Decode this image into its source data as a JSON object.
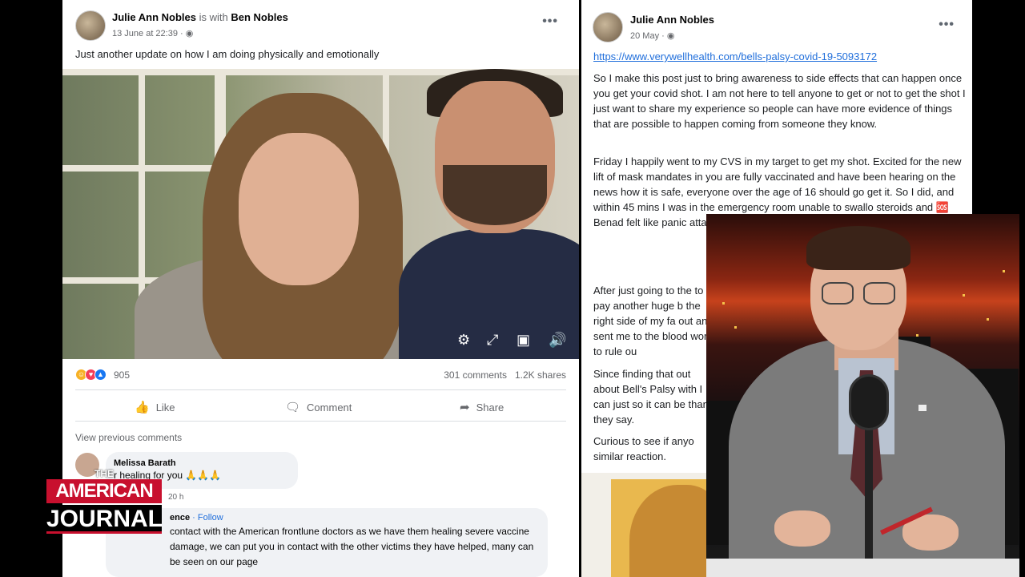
{
  "left_post": {
    "author": "Julie Ann Nobles",
    "with_text": "is with",
    "tagged": "Ben Nobles",
    "date": "13 June at 22:39 ·",
    "privacy_icon": "globe-icon",
    "more_icon": "•••",
    "caption": "Just another update on how I am doing physically and emotionally",
    "video_controls": [
      "gear-icon",
      "expand-icon",
      "picture-in-picture-icon",
      "volume-icon"
    ],
    "reactions": {
      "count": "905",
      "icons": [
        "haha",
        "love",
        "like"
      ]
    },
    "stats": {
      "comments": "301 comments",
      "shares": "1.2K shares"
    },
    "actions": {
      "like": "Like",
      "comment": "Comment",
      "share": "Share"
    },
    "view_previous": "View previous comments",
    "comments": [
      {
        "name": "Melissa Barath",
        "text": "r healing for you 🙏🙏🙏",
        "time": "20 h"
      },
      {
        "name": "ence",
        "follow": " · Follow",
        "text": "contact with the American frontlune doctors as we have them healing severe vaccine damage, we can put you in contact with the other victims they have helped, many can be seen on our page"
      }
    ]
  },
  "right_post": {
    "author": "Julie Ann Nobles",
    "date": "20 May ·",
    "privacy_icon": "globe-icon",
    "more_icon": "•••",
    "link": "https://www.verywellhealth.com/bells-palsy-covid-19-5093172",
    "p1": "So I make this post just to bring awareness to side effects that can happen once you get your covid shot. I am not here to tell anyone to get or not to get the shot I just want to share my experience so people can have more evidence of things that are possible to happen coming from someone they know.",
    "p2": "Friday I happily went to my CVS in my target to get my shot. Excited for the new lift of mask mandates in you are fully vaccinated and have been hearing on the news how it is safe, everyone over the age of 16 should go get it. So I did, and within 45 mins I was in the emergency room unable to swallo steroids and 🆘 Benad felt like panic attack tv numbness.",
    "p3": "After just going to the to pay another huge b the right side of my fa out and sent me to the blood work to rule ou",
    "p4": "Since finding that out about Bell's Palsy with I can just so it can be than they say.",
    "p5": "Curious to see if anyo similar reaction."
  },
  "logo": {
    "the": "THE",
    "american": "AMERICAN",
    "journal": "JOURNAL"
  },
  "colors": {
    "fb_blue": "#216fdb",
    "logo_red": "#c8102e",
    "text_dark": "#1c1e21",
    "text_muted": "#65676b"
  }
}
